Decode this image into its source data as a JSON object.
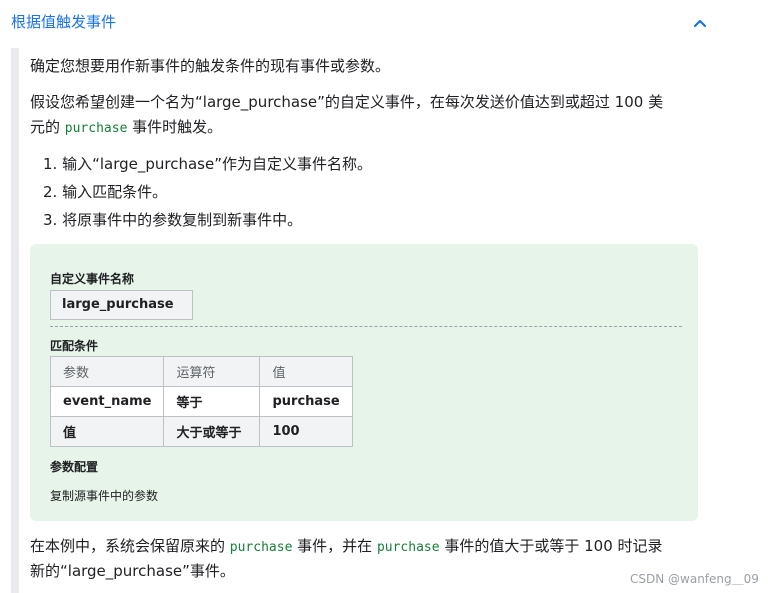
{
  "header": {
    "title": "根据值触发事件",
    "toggle_icon": "chevron-up-icon"
  },
  "intro": "确定您想要用作新事件的触发条件的现有事件或参数。",
  "example": {
    "line1": "假设您希望创建一个名为“large_purchase”的自定义事件，在每次发送价值达到或超过 100 美",
    "line2_prefix": "元的 ",
    "line2_code": "purchase",
    "line2_suffix": " 事件时触发。"
  },
  "steps": [
    "1. 输入“large_purchase”作为自定义事件名称。",
    "2. 输入匹配条件。",
    "3. 将原事件中的参数复制到新事件中。"
  ],
  "panel": {
    "event_name_label": "自定义事件名称",
    "event_name_value": "large_purchase",
    "conditions_label": "匹配条件",
    "table": {
      "headers": [
        "参数",
        "运算符",
        "值"
      ],
      "rows": [
        [
          "event_name",
          "等于",
          "purchase"
        ],
        [
          "值",
          "大于或等于",
          "100"
        ]
      ]
    },
    "param_config_label": "参数配置",
    "param_config_value": "复制源事件中的参数"
  },
  "conclusion": {
    "line1_prefix": "在本例中，系统会保留原来的 ",
    "line1_code1": "purchase",
    "line1_mid": " 事件，并在 ",
    "line1_code2": "purchase",
    "line1_suffix": " 事件的值大于或等于 100 时记录",
    "line2": "新的“large_purchase”事件。"
  },
  "watermark": "CSDN @wanfeng＿09",
  "colors": {
    "link_blue": "#1a73e8",
    "panel_green": "#e6f4ea",
    "code_green": "#188038"
  }
}
